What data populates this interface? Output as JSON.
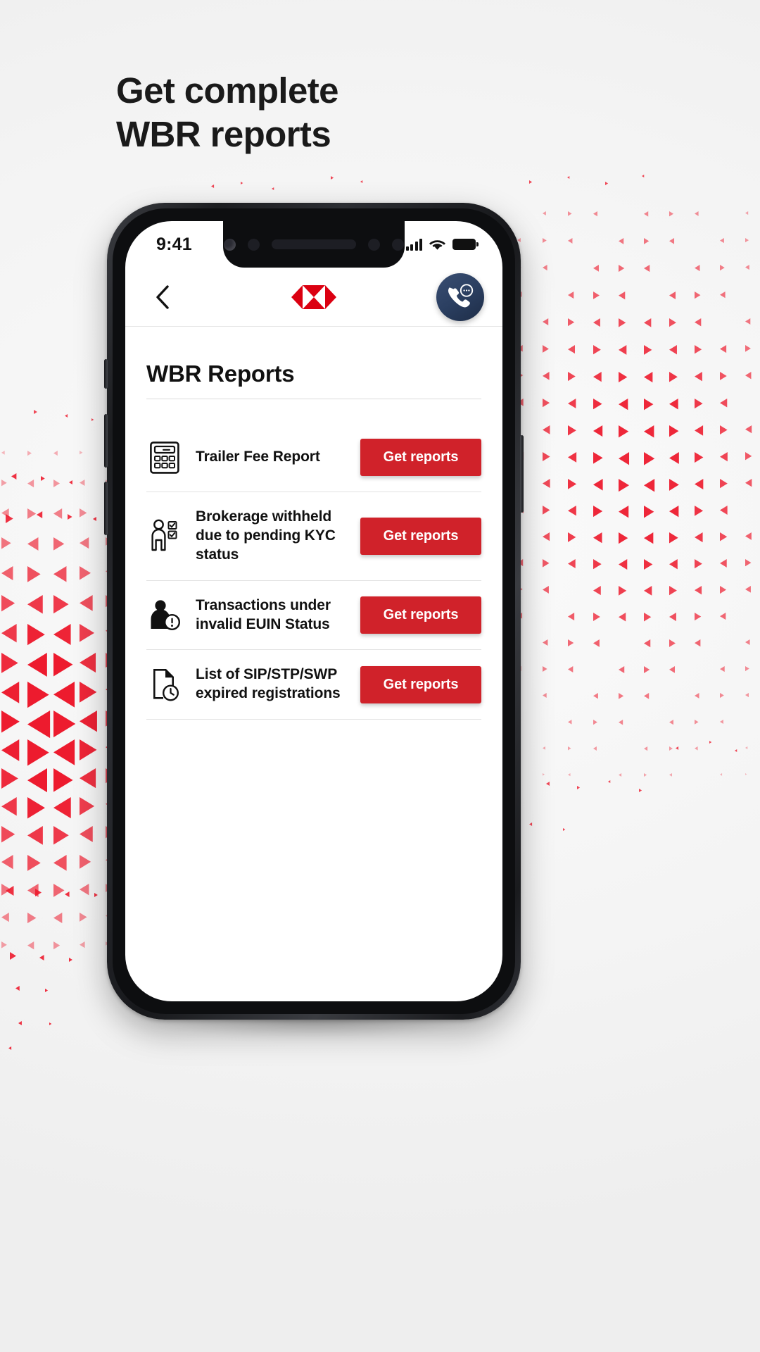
{
  "promo": {
    "headline_line1": "Get complete",
    "headline_line2": "WBR reports"
  },
  "colors": {
    "brand_red": "#d0222a",
    "hsbc_red": "#db0011",
    "call_button_navy": "#2b3f61",
    "page_background": "#f4f4f4"
  },
  "phone": {
    "status_bar": {
      "time": "9:41",
      "signal_icon": "cellular-bars-icon",
      "wifi_icon": "wifi-icon",
      "battery_icon": "battery-full-icon"
    },
    "header": {
      "back_icon": "chevron-left-icon",
      "logo_icon": "hsbc-hexagon-logo",
      "call_icon": "phone-chat-icon"
    },
    "page": {
      "title": "WBR Reports",
      "reports": [
        {
          "icon": "calculator-icon",
          "label": "Trailer Fee Report",
          "button_label": "Get reports"
        },
        {
          "icon": "person-checklist-icon",
          "label": "Brokerage withheld due to pending KYC status",
          "button_label": "Get reports"
        },
        {
          "icon": "person-alert-icon",
          "label": "Transactions under invalid EUIN Status",
          "button_label": "Get reports"
        },
        {
          "icon": "document-clock-icon",
          "label": "List of SIP/STP/SWP expired registrations",
          "button_label": "Get reports"
        }
      ]
    }
  }
}
